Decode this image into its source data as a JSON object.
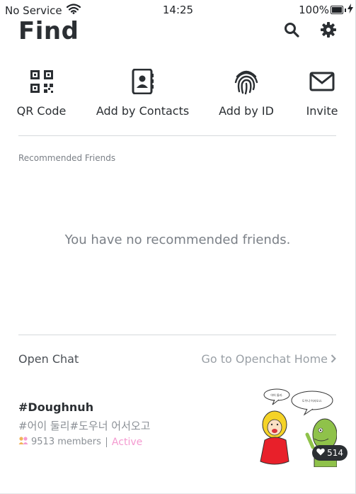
{
  "status_bar": {
    "carrier": "No Service",
    "time": "14:25",
    "battery": "100%"
  },
  "header": {
    "title": "Find"
  },
  "actions": [
    {
      "label": "QR Code",
      "icon": "qr-code-icon"
    },
    {
      "label": "Add by Contacts",
      "icon": "contacts-book-icon"
    },
    {
      "label": "Add by ID",
      "icon": "fingerprint-icon"
    },
    {
      "label": "Invite",
      "icon": "envelope-icon"
    }
  ],
  "recommended": {
    "title": "Recommended Friends",
    "empty_message": "You have no recommended friends."
  },
  "open_chat": {
    "title": "Open Chat",
    "home_link": "Go to Openchat Home",
    "room": {
      "name": "#Doughnuh",
      "tags": "#어이 둘리#도우너 어서오고",
      "members": "9513 members",
      "status": "Active",
      "likes": "514"
    }
  },
  "colors": {
    "text_primary": "#2b2f33",
    "text_secondary": "#7b8087",
    "active": "#f49ad0",
    "divider": "#d6d9dc"
  }
}
